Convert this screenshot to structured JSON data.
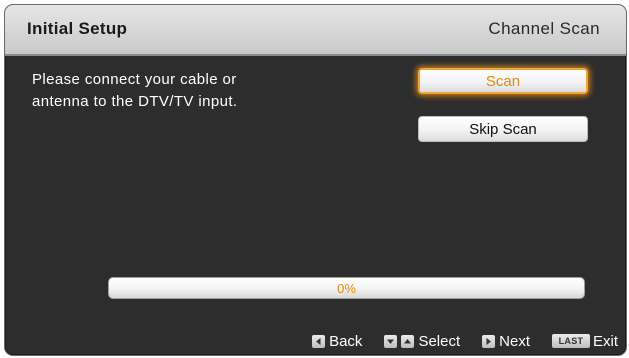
{
  "header": {
    "title": "Initial Setup",
    "screen_name": "Channel Scan"
  },
  "message": {
    "line1": "Please connect your cable or",
    "line2": "antenna to the DTV/TV input."
  },
  "buttons": {
    "scan": "Scan",
    "skip_scan": "Skip Scan"
  },
  "progress": {
    "value": 0,
    "label": "0%"
  },
  "footer": {
    "back": "Back",
    "select": "Select",
    "next": "Next",
    "last_key": "LAST",
    "exit": "Exit"
  },
  "icons": {
    "back": "left-arrow-key-icon",
    "select_down": "down-arrow-key-icon",
    "select_up": "up-arrow-key-icon",
    "next": "right-arrow-key-icon",
    "exit": "last-key-icon"
  },
  "colors": {
    "accent": "#e08a12",
    "background": "#2d2d2d",
    "header": "#d8d8d8"
  }
}
